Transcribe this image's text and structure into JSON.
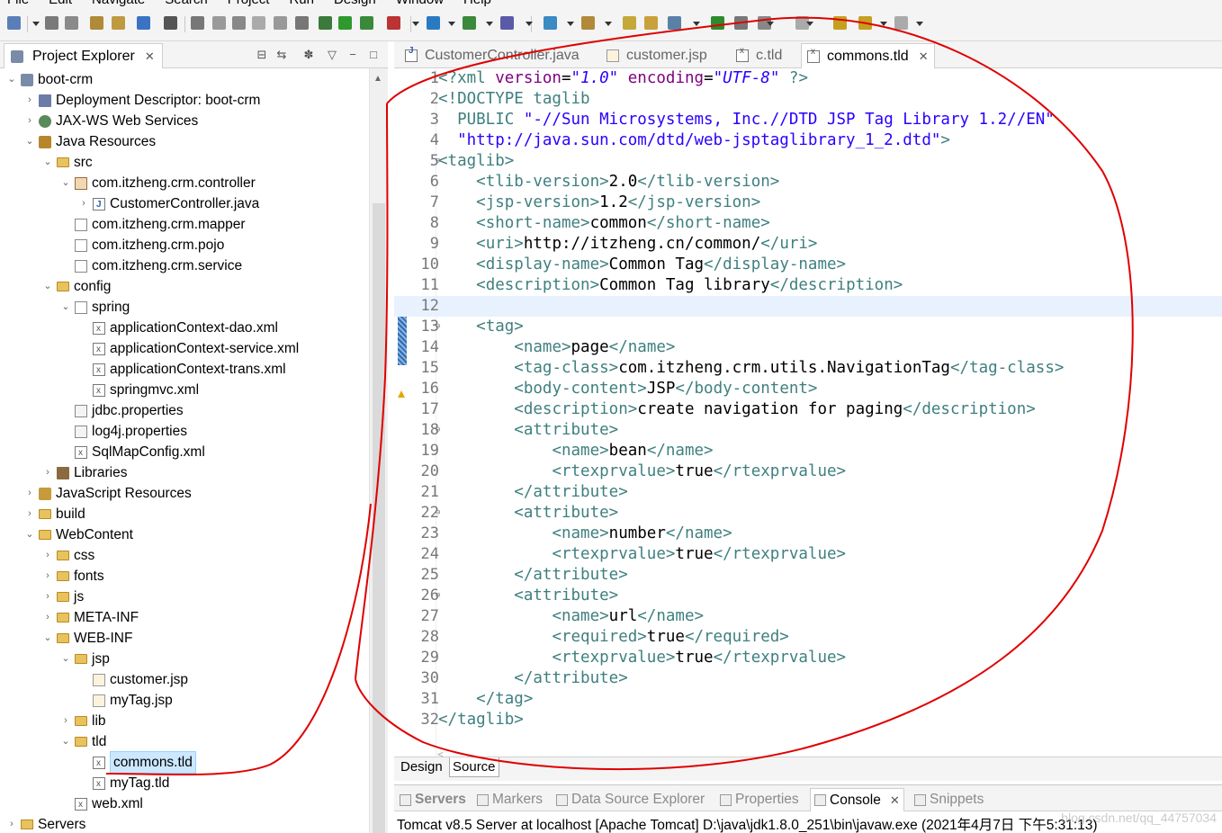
{
  "menu": [
    "File",
    "Edit",
    "Navigate",
    "Search",
    "Project",
    "Run",
    "Design",
    "Window",
    "Help"
  ],
  "explorer": {
    "title": "Project Explorer",
    "tree": [
      {
        "depth": 0,
        "tw": "open",
        "icon": "project",
        "label": "boot-crm"
      },
      {
        "depth": 1,
        "tw": "closed",
        "icon": "dd",
        "label": "Deployment Descriptor: boot-crm"
      },
      {
        "depth": 1,
        "tw": "closed",
        "icon": "ws",
        "label": "JAX-WS Web Services"
      },
      {
        "depth": 1,
        "tw": "open",
        "icon": "java-res",
        "label": "Java Resources"
      },
      {
        "depth": 2,
        "tw": "open",
        "icon": "folder",
        "label": "src"
      },
      {
        "depth": 3,
        "tw": "open",
        "icon": "pkg",
        "label": "com.itzheng.crm.controller"
      },
      {
        "depth": 4,
        "tw": "closed",
        "icon": "java",
        "label": "CustomerController.java"
      },
      {
        "depth": 3,
        "tw": "none",
        "icon": "pkg-empty",
        "label": "com.itzheng.crm.mapper"
      },
      {
        "depth": 3,
        "tw": "none",
        "icon": "pkg-empty",
        "label": "com.itzheng.crm.pojo"
      },
      {
        "depth": 3,
        "tw": "none",
        "icon": "pkg-empty",
        "label": "com.itzheng.crm.service"
      },
      {
        "depth": 2,
        "tw": "open",
        "icon": "folder",
        "label": "config"
      },
      {
        "depth": 3,
        "tw": "open",
        "icon": "pkg-empty",
        "label": "spring"
      },
      {
        "depth": 4,
        "tw": "none",
        "icon": "xml",
        "label": "applicationContext-dao.xml"
      },
      {
        "depth": 4,
        "tw": "none",
        "icon": "xml",
        "label": "applicationContext-service.xml"
      },
      {
        "depth": 4,
        "tw": "none",
        "icon": "xml",
        "label": "applicationContext-trans.xml"
      },
      {
        "depth": 4,
        "tw": "none",
        "icon": "xml",
        "label": "springmvc.xml"
      },
      {
        "depth": 3,
        "tw": "none",
        "icon": "prop",
        "label": "jdbc.properties"
      },
      {
        "depth": 3,
        "tw": "none",
        "icon": "prop",
        "label": "log4j.properties"
      },
      {
        "depth": 3,
        "tw": "none",
        "icon": "xml",
        "label": "SqlMapConfig.xml"
      },
      {
        "depth": 2,
        "tw": "closed",
        "icon": "lib",
        "label": "Libraries"
      },
      {
        "depth": 1,
        "tw": "closed",
        "icon": "js-res",
        "label": "JavaScript Resources"
      },
      {
        "depth": 1,
        "tw": "closed",
        "icon": "folder",
        "label": "build"
      },
      {
        "depth": 1,
        "tw": "open",
        "icon": "folder",
        "label": "WebContent"
      },
      {
        "depth": 2,
        "tw": "closed",
        "icon": "folder",
        "label": "css"
      },
      {
        "depth": 2,
        "tw": "closed",
        "icon": "folder",
        "label": "fonts"
      },
      {
        "depth": 2,
        "tw": "closed",
        "icon": "folder",
        "label": "js"
      },
      {
        "depth": 2,
        "tw": "closed",
        "icon": "folder",
        "label": "META-INF"
      },
      {
        "depth": 2,
        "tw": "open",
        "icon": "folder",
        "label": "WEB-INF"
      },
      {
        "depth": 3,
        "tw": "open",
        "icon": "folder",
        "label": "jsp"
      },
      {
        "depth": 4,
        "tw": "none",
        "icon": "jsp",
        "label": "customer.jsp"
      },
      {
        "depth": 4,
        "tw": "none",
        "icon": "jsp",
        "label": "myTag.jsp"
      },
      {
        "depth": 3,
        "tw": "closed",
        "icon": "folder",
        "label": "lib"
      },
      {
        "depth": 3,
        "tw": "open",
        "icon": "folder",
        "label": "tld"
      },
      {
        "depth": 4,
        "tw": "none",
        "icon": "xml",
        "label": "commons.tld",
        "selected": true
      },
      {
        "depth": 4,
        "tw": "none",
        "icon": "xml",
        "label": "myTag.tld"
      },
      {
        "depth": 3,
        "tw": "none",
        "icon": "xml",
        "label": "web.xml"
      },
      {
        "depth": 0,
        "tw": "closed",
        "icon": "servers",
        "label": "Servers"
      }
    ]
  },
  "editor": {
    "tabs": [
      {
        "label": "CustomerController.java",
        "icon": "java",
        "active": false
      },
      {
        "label": "customer.jsp",
        "icon": "jsp",
        "active": false
      },
      {
        "label": "c.tld",
        "icon": "xml",
        "active": false
      },
      {
        "label": "commons.tld",
        "icon": "xml",
        "active": true
      }
    ],
    "lines": [
      {
        "n": "1",
        "segs": [
          [
            "t",
            "<?xml "
          ],
          [
            "a",
            "version"
          ],
          [
            "tx",
            "="
          ],
          [
            "v",
            "\"1.0\""
          ],
          [
            "tx",
            " "
          ],
          [
            "a",
            "encoding"
          ],
          [
            "tx",
            "="
          ],
          [
            "v",
            "\"UTF-8\""
          ],
          [
            "tx",
            " "
          ],
          [
            "t",
            "?>"
          ]
        ]
      },
      {
        "n": "2",
        "segs": [
          [
            "d",
            "<!DOCTYPE taglib"
          ]
        ]
      },
      {
        "n": "3",
        "segs": [
          [
            "d",
            "  PUBLIC "
          ],
          [
            "s",
            "\"-//Sun Microsystems, Inc.//DTD JSP Tag Library 1.2//EN\""
          ]
        ]
      },
      {
        "n": "4",
        "segs": [
          [
            "s",
            "  \"http://java.sun.com/dtd/web-jsptaglibrary_1_2.dtd\""
          ],
          [
            "d",
            ">"
          ]
        ]
      },
      {
        "n": "5",
        "fold": true,
        "segs": [
          [
            "t",
            "<taglib>"
          ]
        ]
      },
      {
        "n": "6",
        "segs": [
          [
            "tx",
            "    "
          ],
          [
            "t",
            "<tlib-version>"
          ],
          [
            "tx",
            "2.0"
          ],
          [
            "t",
            "</tlib-version>"
          ]
        ]
      },
      {
        "n": "7",
        "segs": [
          [
            "tx",
            "    "
          ],
          [
            "t",
            "<jsp-version>"
          ],
          [
            "tx",
            "1.2"
          ],
          [
            "t",
            "</jsp-version>"
          ]
        ]
      },
      {
        "n": "8",
        "segs": [
          [
            "tx",
            "    "
          ],
          [
            "t",
            "<short-name>"
          ],
          [
            "tx",
            "common"
          ],
          [
            "t",
            "</short-name>"
          ]
        ]
      },
      {
        "n": "9",
        "segs": [
          [
            "tx",
            "    "
          ],
          [
            "t",
            "<uri>"
          ],
          [
            "tx",
            "http://itzheng.cn/common/"
          ],
          [
            "t",
            "</uri>"
          ]
        ]
      },
      {
        "n": "10",
        "segs": [
          [
            "tx",
            "    "
          ],
          [
            "t",
            "<display-name>"
          ],
          [
            "tx",
            "Common Tag"
          ],
          [
            "t",
            "</display-name>"
          ]
        ]
      },
      {
        "n": "11",
        "segs": [
          [
            "tx",
            "    "
          ],
          [
            "t",
            "<description>"
          ],
          [
            "tx",
            "Common Tag library"
          ],
          [
            "t",
            "</description>"
          ]
        ]
      },
      {
        "n": "12",
        "hl": true,
        "segs": []
      },
      {
        "n": "13",
        "fold": true,
        "segs": [
          [
            "tx",
            "    "
          ],
          [
            "t",
            "<tag>"
          ]
        ]
      },
      {
        "n": "14",
        "segs": [
          [
            "tx",
            "        "
          ],
          [
            "t",
            "<name>"
          ],
          [
            "tx",
            "page"
          ],
          [
            "t",
            "</name>"
          ]
        ]
      },
      {
        "n": "15",
        "segs": [
          [
            "tx",
            "        "
          ],
          [
            "t",
            "<tag-class>"
          ],
          [
            "tx",
            "com.itzheng.crm.utils.NavigationTag"
          ],
          [
            "t",
            "</tag-class>"
          ]
        ]
      },
      {
        "n": "16",
        "segs": [
          [
            "tx",
            "        "
          ],
          [
            "t",
            "<body-content>"
          ],
          [
            "tx",
            "JSP"
          ],
          [
            "t",
            "</body-content>"
          ]
        ]
      },
      {
        "n": "17",
        "segs": [
          [
            "tx",
            "        "
          ],
          [
            "t",
            "<description>"
          ],
          [
            "tx",
            "create navigation for paging"
          ],
          [
            "t",
            "</description>"
          ]
        ]
      },
      {
        "n": "18",
        "fold": true,
        "segs": [
          [
            "tx",
            "        "
          ],
          [
            "t",
            "<attribute>"
          ]
        ]
      },
      {
        "n": "19",
        "segs": [
          [
            "tx",
            "            "
          ],
          [
            "t",
            "<name>"
          ],
          [
            "tx",
            "bean"
          ],
          [
            "t",
            "</name>"
          ]
        ]
      },
      {
        "n": "20",
        "segs": [
          [
            "tx",
            "            "
          ],
          [
            "t",
            "<rtexprvalue>"
          ],
          [
            "tx",
            "true"
          ],
          [
            "t",
            "</rtexprvalue>"
          ]
        ]
      },
      {
        "n": "21",
        "segs": [
          [
            "tx",
            "        "
          ],
          [
            "t",
            "</attribute>"
          ]
        ]
      },
      {
        "n": "22",
        "fold": true,
        "segs": [
          [
            "tx",
            "        "
          ],
          [
            "t",
            "<attribute>"
          ]
        ]
      },
      {
        "n": "23",
        "segs": [
          [
            "tx",
            "            "
          ],
          [
            "t",
            "<name>"
          ],
          [
            "tx",
            "number"
          ],
          [
            "t",
            "</name>"
          ]
        ]
      },
      {
        "n": "24",
        "segs": [
          [
            "tx",
            "            "
          ],
          [
            "t",
            "<rtexprvalue>"
          ],
          [
            "tx",
            "true"
          ],
          [
            "t",
            "</rtexprvalue>"
          ]
        ]
      },
      {
        "n": "25",
        "segs": [
          [
            "tx",
            "        "
          ],
          [
            "t",
            "</attribute>"
          ]
        ]
      },
      {
        "n": "26",
        "fold": true,
        "segs": [
          [
            "tx",
            "        "
          ],
          [
            "t",
            "<attribute>"
          ]
        ]
      },
      {
        "n": "27",
        "segs": [
          [
            "tx",
            "            "
          ],
          [
            "t",
            "<name>"
          ],
          [
            "tx",
            "url"
          ],
          [
            "t",
            "</name>"
          ]
        ]
      },
      {
        "n": "28",
        "segs": [
          [
            "tx",
            "            "
          ],
          [
            "t",
            "<required>"
          ],
          [
            "tx",
            "true"
          ],
          [
            "t",
            "</required>"
          ]
        ]
      },
      {
        "n": "29",
        "segs": [
          [
            "tx",
            "            "
          ],
          [
            "t",
            "<rtexprvalue>"
          ],
          [
            "tx",
            "true"
          ],
          [
            "t",
            "</rtexprvalue>"
          ]
        ]
      },
      {
        "n": "30",
        "segs": [
          [
            "tx",
            "        "
          ],
          [
            "t",
            "</attribute>"
          ]
        ]
      },
      {
        "n": "31",
        "segs": [
          [
            "tx",
            "    "
          ],
          [
            "t",
            "</tag>"
          ]
        ]
      },
      {
        "n": "32",
        "segs": [
          [
            "t",
            "</taglib>"
          ]
        ]
      }
    ],
    "design_label": "Design",
    "source_label": "Source"
  },
  "bottom": {
    "tabs": [
      {
        "label": "Servers",
        "active": false,
        "bold": true
      },
      {
        "label": "Markers",
        "active": false
      },
      {
        "label": "Data Source Explorer",
        "active": false
      },
      {
        "label": "Properties",
        "active": false
      },
      {
        "label": "Console",
        "active": true
      },
      {
        "label": "Snippets",
        "active": false
      }
    ],
    "console_text": "Tomcat v8.5 Server at localhost [Apache Tomcat] D:\\java\\jdk1.8.0_251\\bin\\javaw.exe (2021年4月7日 下午5:31:13)",
    "watermark": "blog.csdn.net/qq_44757034"
  },
  "colors": {
    "tag": "#3f7f7f",
    "attr": "#7f007f",
    "value": "#2a00ff",
    "selection": "#cce8ff",
    "annotation": "#e00000"
  }
}
